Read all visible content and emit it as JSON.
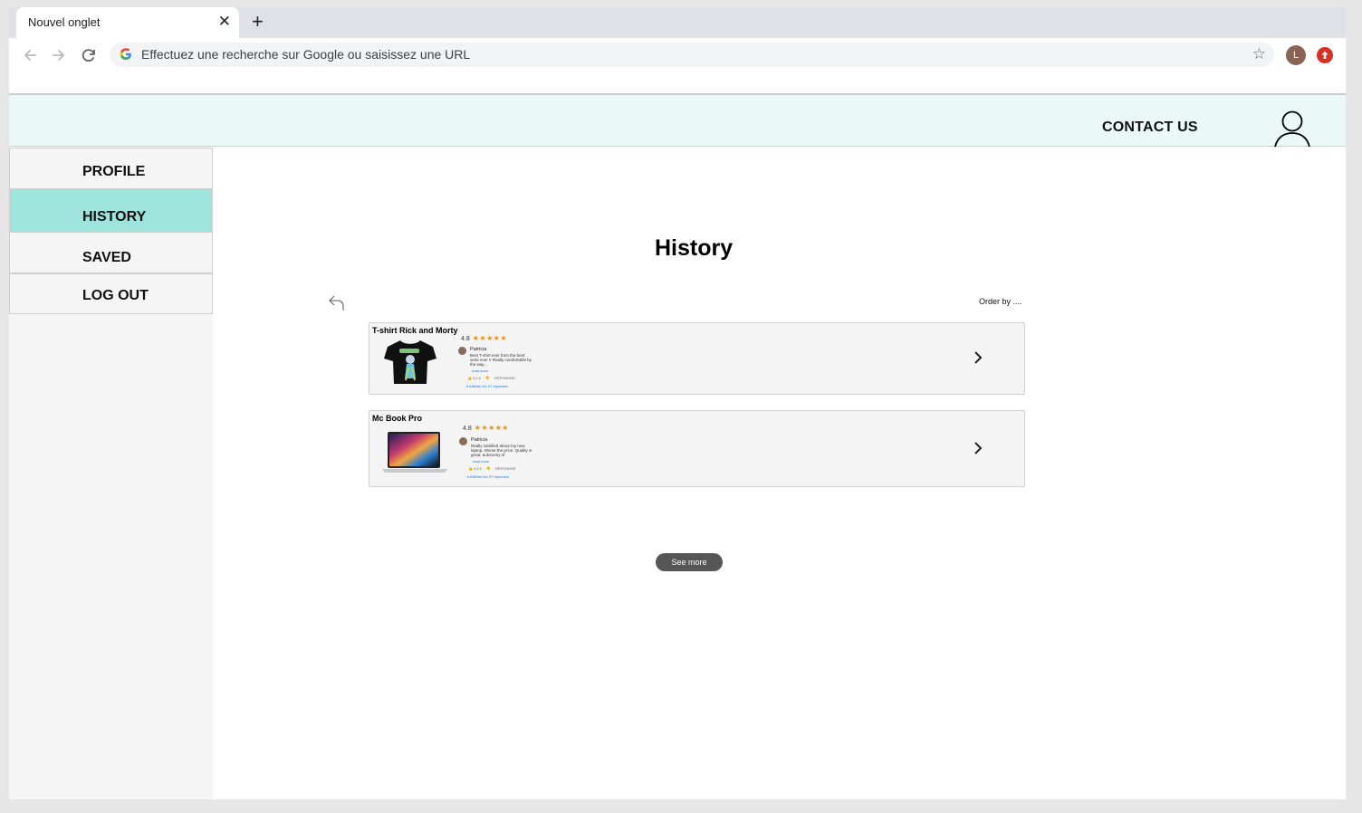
{
  "browser": {
    "tab_title": "Nouvel onglet",
    "tab_close": "✕",
    "new_tab": "+",
    "omnibox_placeholder": "Effectuez une recherche sur Google ou saisissez une URL",
    "profile_initial": "L",
    "star": "☆"
  },
  "header": {
    "contact_label": "CONTACT US"
  },
  "sidebar": {
    "items": [
      {
        "label": "PROFILE"
      },
      {
        "label": "HISTORY",
        "active": true
      },
      {
        "label": "SAVED"
      },
      {
        "label": "LOG OUT"
      }
    ]
  },
  "main": {
    "title": "History",
    "order_by": "Order by ....",
    "see_more": "See more",
    "items": [
      {
        "title": "T-shirt Rick and Morty",
        "rating": "4.8",
        "stars": "★★★★★",
        "reviewer": "Patricia",
        "review_text": "Best T-shirt ever from the best serie ever !! Really comfortable by the way...",
        "read_more": "read more",
        "likes": "9,2 k",
        "reply": "RÉPONDRE",
        "show_replies": "Afficher les 97 réponses"
      },
      {
        "title": "Mc Book Pro",
        "rating": "4.8",
        "stars": "★★★★★",
        "reviewer": "Patricia",
        "review_text": "Really satisfied about my new laptop. Worse the price. Quality is great, autonomy of",
        "read_more": "read more",
        "likes": "9,2 k",
        "reply": "RÉPONDRE",
        "show_replies": "Afficher les 97 réponses"
      }
    ]
  },
  "colors": {
    "header_bg": "#eaf8f8",
    "active_nav": "#9ee4dc",
    "stars": "#f08c00",
    "see_more_bg": "#565656"
  }
}
